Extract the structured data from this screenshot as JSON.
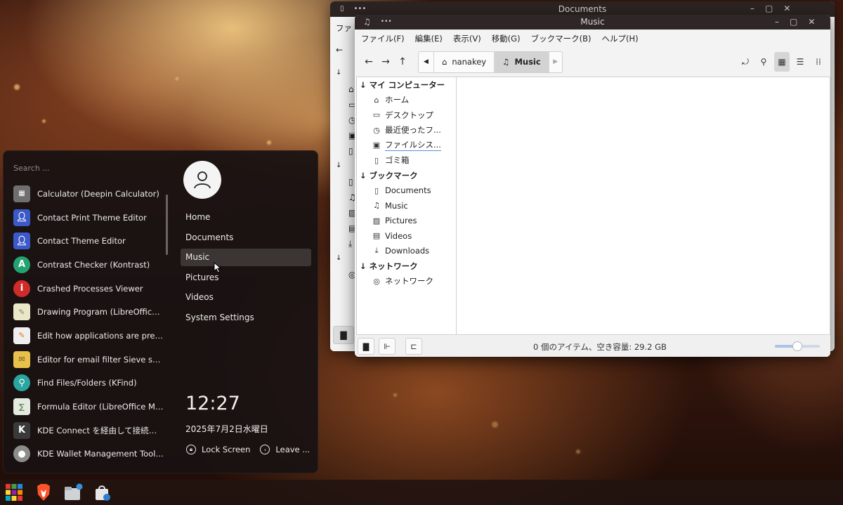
{
  "launcher": {
    "search_placeholder": "Search ...",
    "apps": [
      {
        "label": "Calculator (Deepin Calculator)",
        "icon": "calculator-icon",
        "color": "#6f6f6f"
      },
      {
        "label": "Contact Print Theme Editor",
        "icon": "contact-icon",
        "color": "#3c59c9"
      },
      {
        "label": "Contact Theme Editor",
        "icon": "contact-icon",
        "color": "#3c59c9"
      },
      {
        "label": "Contrast Checker (Kontrast)",
        "icon": "contrast-icon",
        "color": "#23a36f"
      },
      {
        "label": "Crashed Processes Viewer",
        "icon": "crash-icon",
        "color": "#d02b2b"
      },
      {
        "label": "Drawing Program (LibreOffice ...",
        "icon": "draw-icon",
        "color": "#eae6c8"
      },
      {
        "label": "Edit how applications are prese...",
        "icon": "menu-edit-icon",
        "color": "#efefef"
      },
      {
        "label": "Editor for email filter Sieve scri...",
        "icon": "mail-filter-icon",
        "color": "#e7c14a"
      },
      {
        "label": "Find Files/Folders (KFind)",
        "icon": "search-icon",
        "color": "#2aa5a0"
      },
      {
        "label": "Formula Editor (LibreOffice Mat...",
        "icon": "formula-icon",
        "color": "#e3eadf"
      },
      {
        "label": "KDE Connect を経由して接続さ...",
        "icon": "kdeconnect-icon",
        "color": "#3a3a3a"
      },
      {
        "label": "KDE Wallet Management Tool (...",
        "icon": "wallet-icon",
        "color": "#8c8c8c"
      }
    ],
    "places": [
      {
        "label": "Home",
        "active": false
      },
      {
        "label": "Documents",
        "active": false
      },
      {
        "label": "Music",
        "active": true
      },
      {
        "label": "Pictures",
        "active": false
      },
      {
        "label": "Videos",
        "active": false
      },
      {
        "label": "System Settings",
        "active": false
      }
    ],
    "clock": "12:27",
    "date": "2025年7月2日水曜日",
    "lock_label": "Lock Screen",
    "leave_label": "Leave ..."
  },
  "back_window": {
    "title": "Documents",
    "menu_fragment": "ファ"
  },
  "window": {
    "title": "Music",
    "menu": [
      "ファイル(F)",
      "編集(E)",
      "表示(V)",
      "移動(G)",
      "ブックマーク(B)",
      "ヘルプ(H)"
    ],
    "breadcrumb": [
      {
        "label": "nanakey",
        "icon": "home-icon",
        "current": false
      },
      {
        "label": "Music",
        "icon": "music-icon",
        "current": true
      }
    ],
    "sidebar": {
      "sections": [
        {
          "title": "マイ コンピューター",
          "items": [
            {
              "label": "ホーム",
              "icon": "home-icon"
            },
            {
              "label": "デスクトップ",
              "icon": "desktop-icon"
            },
            {
              "label": "最近使ったフ...",
              "icon": "clock-icon"
            },
            {
              "label": "ファイルシス...",
              "icon": "drive-icon"
            },
            {
              "label": "ゴミ箱",
              "icon": "trash-icon"
            }
          ]
        },
        {
          "title": "ブックマーク",
          "items": [
            {
              "label": "Documents",
              "icon": "document-icon"
            },
            {
              "label": "Music",
              "icon": "music-icon"
            },
            {
              "label": "Pictures",
              "icon": "picture-icon"
            },
            {
              "label": "Videos",
              "icon": "video-icon"
            },
            {
              "label": "Downloads",
              "icon": "download-icon"
            }
          ]
        },
        {
          "title": "ネットワーク",
          "items": [
            {
              "label": "ネットワーク",
              "icon": "network-icon"
            }
          ]
        }
      ]
    },
    "status": "0 個のアイテム、空き容量: 29.2 GB",
    "zoom_fraction": 0.5
  }
}
